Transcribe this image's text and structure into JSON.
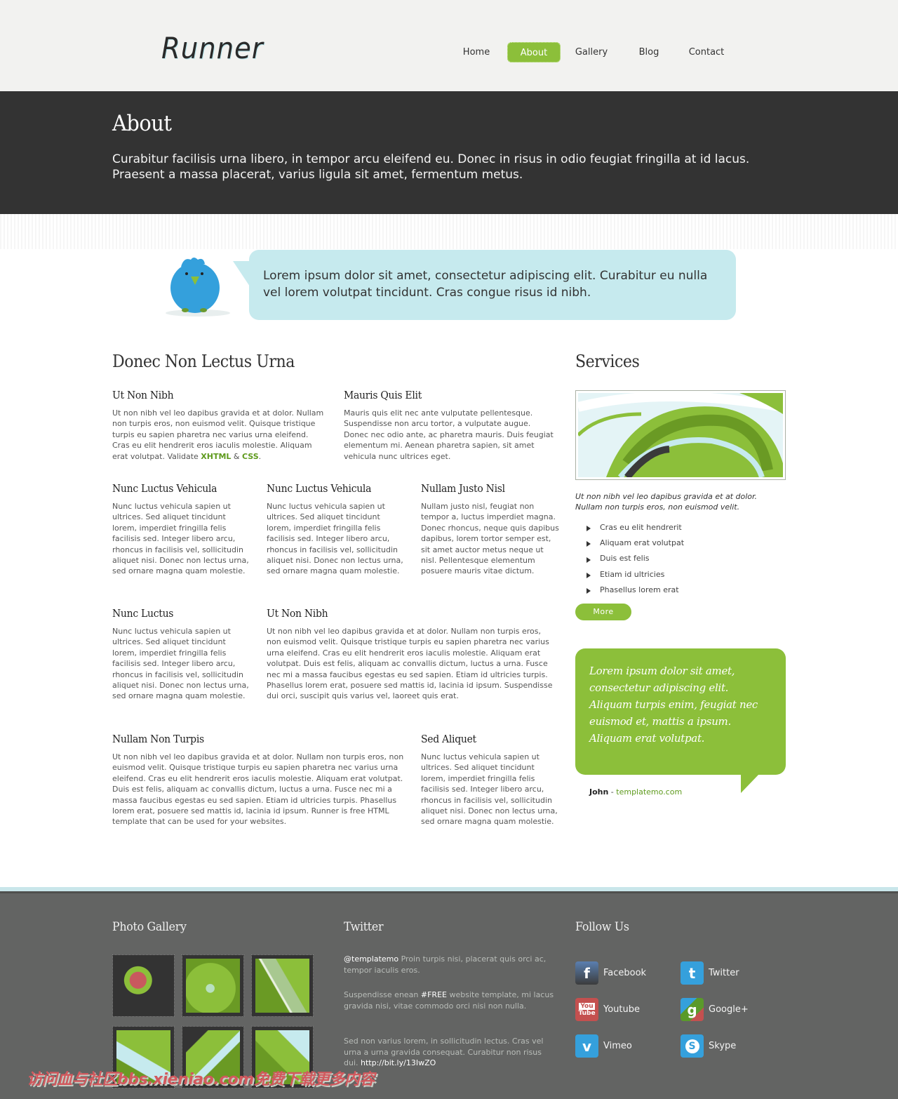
{
  "header": {
    "logo": "Runner",
    "nav": [
      {
        "label": "Home",
        "active": false
      },
      {
        "label": "About",
        "active": true
      },
      {
        "label": "Gallery",
        "active": false
      },
      {
        "label": "Blog",
        "active": false
      },
      {
        "label": "Contact",
        "active": false
      }
    ]
  },
  "banner": {
    "title": "About",
    "text": "Curabitur facilisis urna libero, in tempor arcu eleifend eu. Donec in risus in odio feugiat fringilla at id lacus. Praesent a massa placerat, varius ligula sit amet, fermentum metus."
  },
  "intro_bubble": {
    "icon": "twitter-bird-icon",
    "text": "Lorem ipsum dolor sit amet, consectetur adipiscing elit. Curabitur eu nulla vel lorem volutpat tincidunt. Cras congue risus id nibh."
  },
  "main": {
    "title": "Donec Non Lectus Urna",
    "sections": [
      {
        "title": "Ut Non Nibh",
        "text": "Ut non nibh vel leo dapibus gravida et at dolor. Nullam non turpis eros, non euismod velit. Quisque tristique turpis eu sapien pharetra nec varius urna eleifend. Cras eu elit hendrerit eros iaculis molestie. Aliquam erat volutpat. Validate ",
        "link1": "XHTML",
        "amp": " & ",
        "link2": "CSS",
        "end": "."
      },
      {
        "title": "Mauris Quis Elit",
        "text": "Mauris quis elit nec ante vulputate pellentesque. Suspendisse non arcu tortor, a vulputate augue. Donec nec odio ante, ac pharetra mauris. Duis feugiat elementum mi. Aenean pharetra sapien, sit amet vehicula nunc ultrices eget."
      },
      {
        "title": "Nunc Luctus Vehicula",
        "text": "Nunc luctus vehicula sapien ut ultrices. Sed aliquet tincidunt lorem, imperdiet fringilla felis facilisis sed. Integer libero arcu, rhoncus in facilisis vel, sollicitudin aliquet nisi. Donec non lectus urna, sed ornare magna quam molestie."
      },
      {
        "title": "Nunc Luctus Vehicula",
        "text": "Nunc luctus vehicula sapien ut ultrices. Sed aliquet tincidunt lorem, imperdiet fringilla felis facilisis sed. Integer libero arcu, rhoncus in facilisis vel, sollicitudin aliquet nisi. Donec non lectus urna, sed ornare magna quam molestie."
      },
      {
        "title": "Nullam Justo Nisl",
        "text": "Nullam justo nisl, feugiat non tempor a, luctus imperdiet magna. Donec rhoncus, neque quis dapibus dapibus, lorem tortor semper est, sit amet auctor metus neque ut nisl. Pellentesque elementum posuere mauris vitae dictum."
      },
      {
        "title": "Nunc Luctus",
        "text": "Nunc luctus vehicula sapien ut ultrices. Sed aliquet tincidunt lorem, imperdiet fringilla felis facilisis sed. Integer libero arcu, rhoncus in facilisis vel, sollicitudin aliquet nisi. Donec non lectus urna, sed ornare magna quam molestie."
      },
      {
        "title": "Ut Non Nibh",
        "text": "Ut non nibh vel leo dapibus gravida et at dolor. Nullam non turpis eros, non euismod velit. Quisque tristique turpis eu sapien pharetra nec varius urna eleifend. Cras eu elit hendrerit eros iaculis molestie. Aliquam erat volutpat. Duis est felis, aliquam ac convallis dictum, luctus a urna. Fusce nec mi a massa faucibus egestas eu sed sapien. Etiam id ultricies turpis. Phasellus lorem erat, posuere sed mattis id, lacinia id ipsum. Suspendisse dui orci, suscipit quis varius vel, laoreet quis erat."
      },
      {
        "title": "Nullam Non Turpis",
        "text": "Ut non nibh vel leo dapibus gravida et at dolor. Nullam non turpis eros, non euismod velit. Quisque tristique turpis eu sapien pharetra nec varius urna eleifend. Cras eu elit hendrerit eros iaculis molestie. Aliquam erat volutpat. Duis est felis, aliquam ac convallis dictum, luctus a urna. Fusce nec mi a massa faucibus egestas eu sed sapien. Etiam id ultricies turpis. Phasellus lorem erat, posuere sed mattis id, lacinia id ipsum. Runner is free HTML template that can be used for your websites."
      },
      {
        "title": "Sed Aliquet",
        "text": "Nunc luctus vehicula sapien ut ultrices. Sed aliquet tincidunt lorem, imperdiet fringilla felis facilisis sed. Integer libero arcu, rhoncus in facilisis vel, sollicitudin aliquet nisi. Donec non lectus urna, sed ornare magna quam molestie."
      }
    ]
  },
  "services": {
    "title": "Services",
    "caption": "Ut non nibh vel leo dapibus gravida et at dolor. Nullam non turpis eros, non euismod velit.",
    "items": [
      "Cras eu elit hendrerit",
      "Aliquam erat volutpat",
      "Duis est felis",
      "Etiam id ultricies",
      "Phasellus lorem erat"
    ],
    "more_label": "More"
  },
  "testimonial": {
    "quote": "Lorem ipsum dolor sit amet, consectetur adipiscing elit. Aliquam turpis enim, feugiat nec euismod et, mattis a ipsum. Aliquam erat volutpat.",
    "author": "John",
    "separator": " - ",
    "site": "templatemo.com"
  },
  "footer": {
    "gallery_title": "Photo Gallery",
    "twitter_title": "Twitter",
    "follow_title": "Follow Us",
    "tweets": [
      {
        "handle": "@templatemo",
        "text": " Proin turpis nisi, placerat quis orci ac, tempor iaculis eros."
      },
      {
        "pre": "Suspendisse enean ",
        "tag": "#FREE",
        "post": " website template, mi lacus gravida nisi, vitae commodo orci nisi non nulla."
      },
      {
        "pre": "Sed non varius lorem, in sollicitudin lectus. Cras vel urna a urna gravida consequat. Curabitur non risus dui. ",
        "link": "http://bit.ly/13IwZO"
      }
    ],
    "social": [
      {
        "label": "Facebook",
        "icon": "facebook-icon",
        "color": "#3b5998"
      },
      {
        "label": "Twitter",
        "icon": "twitter-icon",
        "color": "#35a0dc"
      },
      {
        "label": "Youtube",
        "icon": "youtube-icon",
        "color": "#c4504f"
      },
      {
        "label": "Google+",
        "icon": "google-plus-icon",
        "color": "#5a9a2a"
      },
      {
        "label": "Vimeo",
        "icon": "vimeo-icon",
        "color": "#35a0dc"
      },
      {
        "label": "Skype",
        "icon": "skype-icon",
        "color": "#35a0dc"
      }
    ]
  },
  "watermark": "访问血与社区bbs.xieniao.com免费下载更多内容",
  "colors": {
    "accent": "#8cbf3a",
    "banner_bg": "#333333",
    "bubble_bg": "#c6eaee",
    "footer_bg": "#636463"
  }
}
